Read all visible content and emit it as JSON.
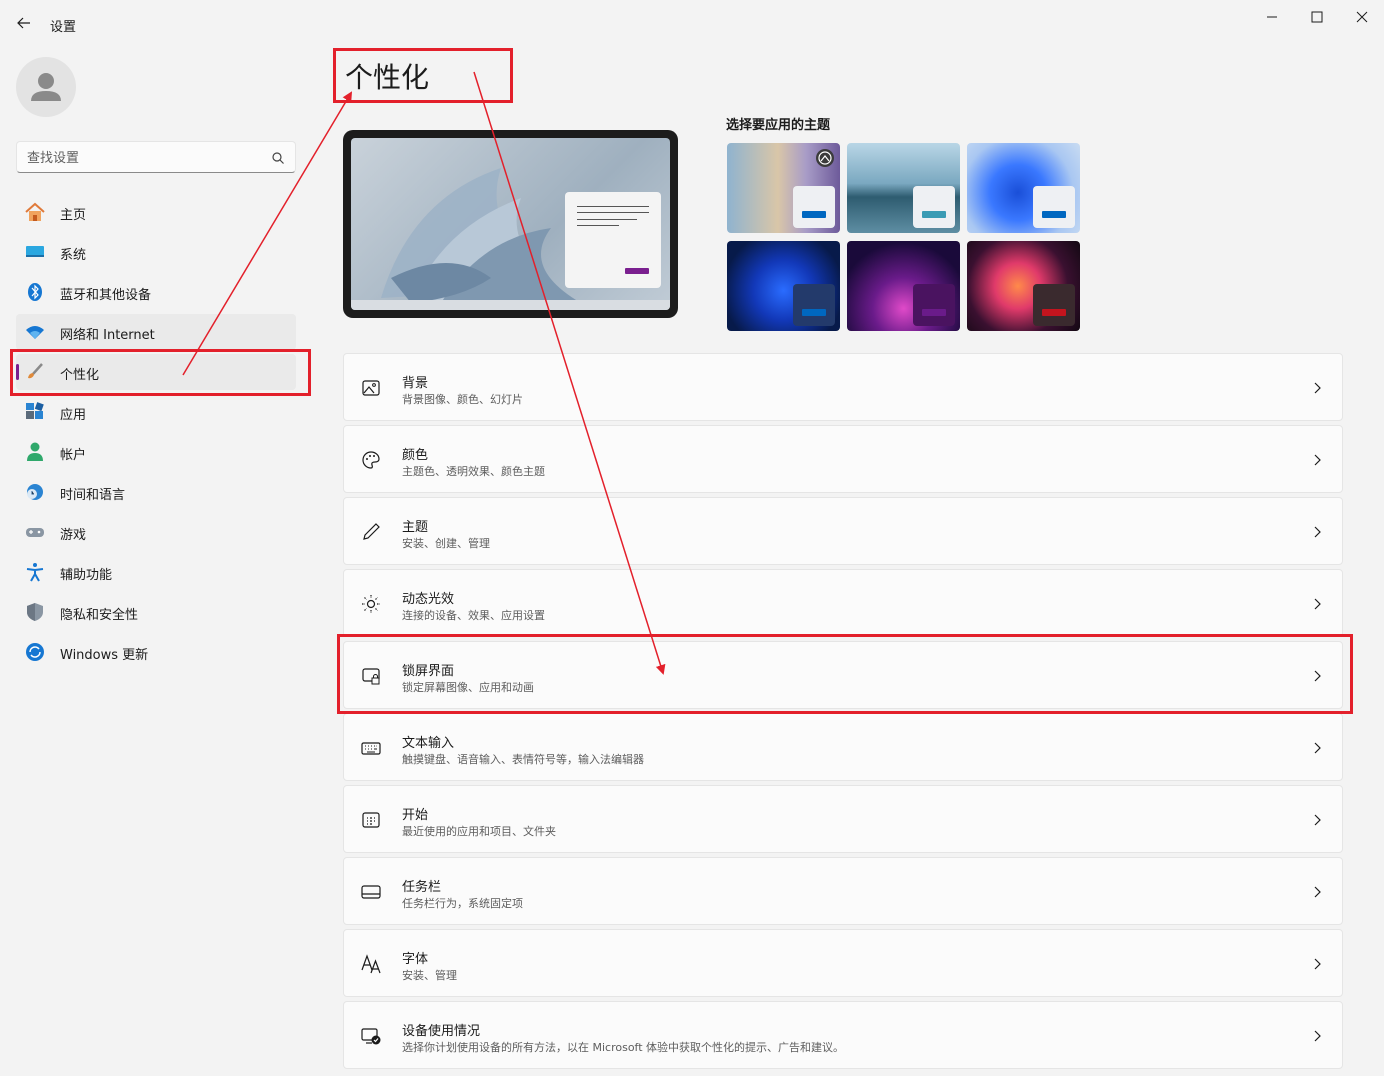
{
  "window": {
    "title": "设置",
    "colors": {
      "accent": "#7a1f8f",
      "annotation": "#e3202b"
    }
  },
  "sidebar": {
    "search_placeholder": "查找设置",
    "items": [
      {
        "label": "主页",
        "icon": "home-icon"
      },
      {
        "label": "系统",
        "icon": "system-icon"
      },
      {
        "label": "蓝牙和其他设备",
        "icon": "bluetooth-icon"
      },
      {
        "label": "网络和 Internet",
        "icon": "wifi-icon"
      },
      {
        "label": "个性化",
        "icon": "brush-icon",
        "active": true
      },
      {
        "label": "应用",
        "icon": "apps-icon"
      },
      {
        "label": "帐户",
        "icon": "account-icon"
      },
      {
        "label": "时间和语言",
        "icon": "clock-globe-icon"
      },
      {
        "label": "游戏",
        "icon": "gamepad-icon"
      },
      {
        "label": "辅助功能",
        "icon": "accessibility-icon"
      },
      {
        "label": "隐私和安全性",
        "icon": "shield-icon"
      },
      {
        "label": "Windows 更新",
        "icon": "update-icon"
      }
    ]
  },
  "main": {
    "title": "个性化",
    "themes_label": "选择要应用的主题",
    "themes": [
      {
        "icon": "theme-spotlight",
        "accent": "#0067c0"
      },
      {
        "icon": "theme-lake",
        "accent": "#3a9bb4"
      },
      {
        "icon": "theme-bloom-light",
        "accent": "#0067c0"
      },
      {
        "icon": "theme-bloom-dark",
        "accent": "#0067c0"
      },
      {
        "icon": "theme-glow",
        "accent": "#6a1b8a"
      },
      {
        "icon": "theme-flow",
        "accent": "#c4141e"
      }
    ],
    "settings": [
      {
        "title": "背景",
        "subtitle": "背景图像、颜色、幻灯片",
        "icon": "picture-icon"
      },
      {
        "title": "颜色",
        "subtitle": "主题色、透明效果、颜色主题",
        "icon": "palette-icon"
      },
      {
        "title": "主题",
        "subtitle": "安装、创建、管理",
        "icon": "pen-icon"
      },
      {
        "title": "动态光效",
        "subtitle": "连接的设备、效果、应用设置",
        "icon": "lighting-icon"
      },
      {
        "title": "锁屏界面",
        "subtitle": "锁定屏幕图像、应用和动画",
        "icon": "lockscreen-icon"
      },
      {
        "title": "文本输入",
        "subtitle": "触摸键盘、语音输入、表情符号等，输入法编辑器",
        "icon": "keyboard-icon"
      },
      {
        "title": "开始",
        "subtitle": "最近使用的应用和项目、文件夹",
        "icon": "start-icon"
      },
      {
        "title": "任务栏",
        "subtitle": "任务栏行为，系统固定项",
        "icon": "taskbar-icon"
      },
      {
        "title": "字体",
        "subtitle": "安装、管理",
        "icon": "font-icon"
      },
      {
        "title": "设备使用情况",
        "subtitle": "选择你计划使用设备的所有方法，以在 Microsoft 体验中获取个性化的提示、广告和建议。",
        "icon": "device-usage-icon"
      }
    ]
  }
}
